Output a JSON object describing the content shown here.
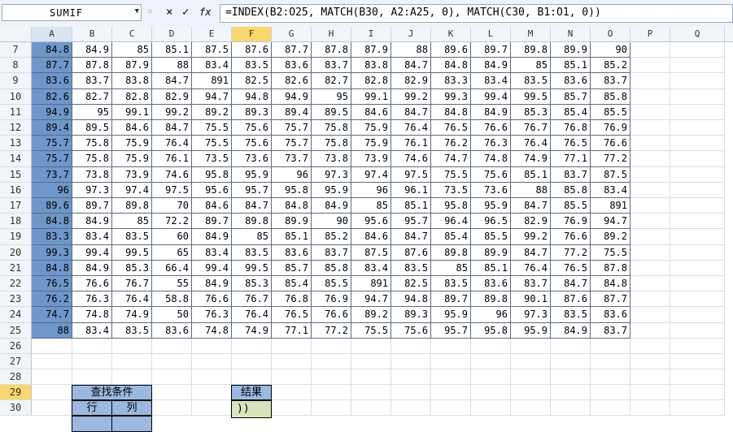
{
  "name_box": {
    "value": "SUMIF"
  },
  "formula_bar": {
    "cancel_icon": "×",
    "enter_icon": "✓",
    "fx_label": "fx",
    "formula_text": "=INDEX(B2:O25, MATCH(B30, A2:A25, 0), MATCH(C30, B1:O1, 0))"
  },
  "columns": [
    "A",
    "B",
    "C",
    "D",
    "E",
    "F",
    "G",
    "H",
    "I",
    "J",
    "K",
    "L",
    "M",
    "N",
    "O",
    "P",
    "Q"
  ],
  "rows": [
    {
      "num": "7",
      "cells": [
        "84.8",
        "84.9",
        "85",
        "85.1",
        "87.5",
        "87.6",
        "87.7",
        "87.8",
        "87.9",
        "88",
        "89.6",
        "89.7",
        "89.8",
        "89.9",
        "90"
      ]
    },
    {
      "num": "8",
      "cells": [
        "87.7",
        "87.8",
        "87.9",
        "88",
        "83.4",
        "83.5",
        "83.6",
        "83.7",
        "83.8",
        "84.7",
        "84.8",
        "84.9",
        "85",
        "85.1",
        "85.2"
      ]
    },
    {
      "num": "9",
      "cells": [
        "83.6",
        "83.7",
        "83.8",
        "84.7",
        "891",
        "82.5",
        "82.6",
        "82.7",
        "82.8",
        "82.9",
        "83.3",
        "83.4",
        "83.5",
        "83.6",
        "83.7"
      ]
    },
    {
      "num": "10",
      "cells": [
        "82.6",
        "82.7",
        "82.8",
        "82.9",
        "94.7",
        "94.8",
        "94.9",
        "95",
        "99.1",
        "99.2",
        "99.3",
        "99.4",
        "99.5",
        "85.7",
        "85.8"
      ]
    },
    {
      "num": "11",
      "cells": [
        "94.9",
        "95",
        "99.1",
        "99.2",
        "89.2",
        "89.3",
        "89.4",
        "89.5",
        "84.6",
        "84.7",
        "84.8",
        "84.9",
        "85.3",
        "85.4",
        "85.5"
      ]
    },
    {
      "num": "12",
      "cells": [
        "89.4",
        "89.5",
        "84.6",
        "84.7",
        "75.5",
        "75.6",
        "75.7",
        "75.8",
        "75.9",
        "76.4",
        "76.5",
        "76.6",
        "76.7",
        "76.8",
        "76.9"
      ]
    },
    {
      "num": "13",
      "cells": [
        "75.7",
        "75.8",
        "75.9",
        "76.4",
        "75.5",
        "75.6",
        "75.7",
        "75.8",
        "75.9",
        "76.1",
        "76.2",
        "76.3",
        "76.4",
        "76.5",
        "76.6"
      ]
    },
    {
      "num": "14",
      "cells": [
        "75.7",
        "75.8",
        "75.9",
        "76.1",
        "73.5",
        "73.6",
        "73.7",
        "73.8",
        "73.9",
        "74.6",
        "74.7",
        "74.8",
        "74.9",
        "77.1",
        "77.2"
      ]
    },
    {
      "num": "15",
      "cells": [
        "73.7",
        "73.8",
        "73.9",
        "74.6",
        "95.8",
        "95.9",
        "96",
        "97.3",
        "97.4",
        "97.5",
        "75.5",
        "75.6",
        "85.1",
        "83.7",
        "87.5"
      ]
    },
    {
      "num": "16",
      "cells": [
        "96",
        "97.3",
        "97.4",
        "97.5",
        "95.6",
        "95.7",
        "95.8",
        "95.9",
        "96",
        "96.1",
        "73.5",
        "73.6",
        "88",
        "85.8",
        "83.4"
      ]
    },
    {
      "num": "17",
      "cells": [
        "89.6",
        "89.7",
        "89.8",
        "70",
        "84.6",
        "84.7",
        "84.8",
        "84.9",
        "85",
        "85.1",
        "95.8",
        "95.9",
        "84.7",
        "85.5",
        "891"
      ]
    },
    {
      "num": "18",
      "cells": [
        "84.8",
        "84.9",
        "85",
        "72.2",
        "89.7",
        "89.8",
        "89.9",
        "90",
        "95.6",
        "95.7",
        "96.4",
        "96.5",
        "82.9",
        "76.9",
        "94.7"
      ]
    },
    {
      "num": "19",
      "cells": [
        "83.3",
        "83.4",
        "83.5",
        "60",
        "84.9",
        "85",
        "85.1",
        "85.2",
        "84.6",
        "84.7",
        "85.4",
        "85.5",
        "99.2",
        "76.6",
        "89.2"
      ]
    },
    {
      "num": "20",
      "cells": [
        "99.3",
        "99.4",
        "99.5",
        "65",
        "83.4",
        "83.5",
        "83.6",
        "83.7",
        "87.5",
        "87.6",
        "89.8",
        "89.9",
        "84.7",
        "77.2",
        "75.5"
      ]
    },
    {
      "num": "21",
      "cells": [
        "84.8",
        "84.9",
        "85.3",
        "66.4",
        "99.4",
        "99.5",
        "85.7",
        "85.8",
        "83.4",
        "83.5",
        "85",
        "85.1",
        "76.4",
        "76.5",
        "87.8"
      ]
    },
    {
      "num": "22",
      "cells": [
        "76.5",
        "76.6",
        "76.7",
        "55",
        "84.9",
        "85.3",
        "85.4",
        "85.5",
        "891",
        "82.5",
        "83.5",
        "83.6",
        "83.7",
        "84.7",
        "84.8"
      ]
    },
    {
      "num": "23",
      "cells": [
        "76.2",
        "76.3",
        "76.4",
        "58.8",
        "76.6",
        "76.7",
        "76.8",
        "76.9",
        "94.7",
        "94.8",
        "89.7",
        "89.8",
        "90.1",
        "87.6",
        "87.7"
      ]
    },
    {
      "num": "24",
      "cells": [
        "74.7",
        "74.8",
        "74.9",
        "50",
        "76.3",
        "76.4",
        "76.5",
        "76.6",
        "89.2",
        "89.3",
        "95.9",
        "96",
        "97.3",
        "83.5",
        "83.6"
      ]
    },
    {
      "num": "25",
      "cells": [
        "88",
        "83.4",
        "83.5",
        "83.6",
        "74.8",
        "74.9",
        "77.1",
        "77.2",
        "75.5",
        "75.6",
        "95.7",
        "95.8",
        "95.9",
        "84.9",
        "83.7"
      ]
    }
  ],
  "empty_rows": [
    "26",
    "27",
    "28",
    "29",
    "30"
  ],
  "lookup_table": {
    "header": "查找条件",
    "row_label": "行",
    "col_label": "列"
  },
  "result_box": {
    "header": "结果",
    "value": "))"
  }
}
